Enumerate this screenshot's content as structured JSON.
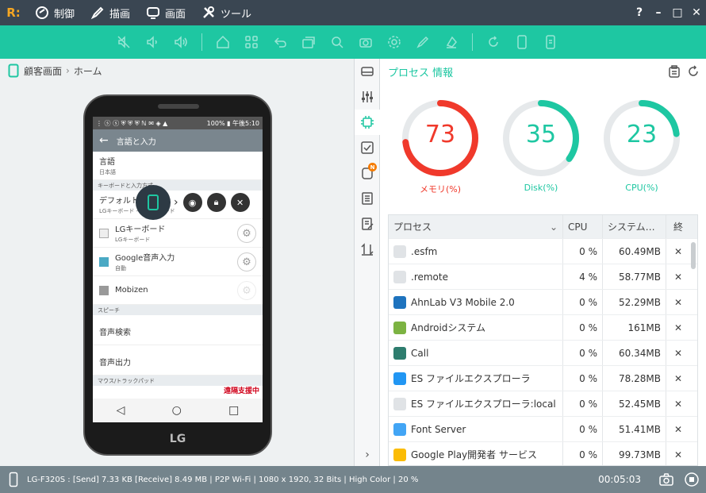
{
  "titlebar": {
    "logo": "R:",
    "menus": [
      "制御",
      "描画",
      "画面",
      "ツール"
    ],
    "controls": [
      "?",
      "–",
      "□",
      "✕"
    ]
  },
  "toolbar": {
    "icons": [
      "mute-icon",
      "volume-down-icon",
      "volume-up-icon",
      "home-icon",
      "apps-icon",
      "back-icon",
      "recent-icon",
      "search-icon",
      "camera-icon",
      "settings-icon",
      "pen-icon",
      "eraser-icon",
      "refresh-icon",
      "phone-portrait-icon",
      "phone-menu-icon"
    ]
  },
  "left": {
    "breadcrumb": [
      "顧客画面",
      "ホーム"
    ],
    "phone": {
      "status_left": "⋮ ⓢ ⓢ ⛨ ⛨ ⛨  ℕ ✉ ◈ ▲",
      "status_right": "100% ▮ 午後5:10",
      "appbar_title": "言語と入力",
      "rows": [
        {
          "title": "言語",
          "sub": "日本語"
        }
      ],
      "section1": "キーボードと入力方式",
      "default_row": {
        "title": "デフォルト",
        "sub": "LGキーボード - LGキーボード"
      },
      "checkrows": [
        {
          "title": "LGキーボード",
          "sub": "LGキーボード"
        },
        {
          "title": "Google音声入力",
          "sub": "自動"
        },
        {
          "title": "Mobizen",
          "sub": ""
        }
      ],
      "section2": "スピーチ",
      "speech_rows": [
        "音声検索",
        "音声出力"
      ],
      "section3": "マウス/トラックパッド",
      "remote_tag": "遠隔支援中",
      "brand": "LG"
    }
  },
  "right": {
    "title": "プロセス 情報",
    "gauges": [
      {
        "value": "73",
        "label": "メモリ(%)",
        "percent": 73,
        "color": "#f0392b"
      },
      {
        "value": "35",
        "label": "Disk(%)",
        "percent": 35,
        "color": "#1ec7a2"
      },
      {
        "value": "23",
        "label": "CPU(%)",
        "percent": 23,
        "color": "#1ec7a2"
      }
    ],
    "table": {
      "headers": [
        "プロセス",
        "CPU",
        "システム…",
        "終"
      ],
      "rows": [
        {
          "name": ".esfm",
          "cpu": "0 %",
          "mem": "60.49MB",
          "icon": "generic-icon",
          "color": "#e0e3e6"
        },
        {
          "name": ".remote",
          "cpu": "4 %",
          "mem": "58.77MB",
          "icon": "generic-icon",
          "color": "#e0e3e6"
        },
        {
          "name": "AhnLab V3 Mobile 2.0",
          "cpu": "0 %",
          "mem": "52.29MB",
          "icon": "v3-icon",
          "color": "#1e73be"
        },
        {
          "name": "Androidシステム",
          "cpu": "0 %",
          "mem": "161MB",
          "icon": "android-icon",
          "color": "#7cb342"
        },
        {
          "name": "Call",
          "cpu": "0 %",
          "mem": "60.34MB",
          "icon": "call-icon",
          "color": "#2e7d6e"
        },
        {
          "name": "ES ファイルエクスプローラ",
          "cpu": "0 %",
          "mem": "78.28MB",
          "icon": "es-icon",
          "color": "#2196f3"
        },
        {
          "name": "ES ファイルエクスプローラ:local",
          "cpu": "0 %",
          "mem": "52.45MB",
          "icon": "generic-icon",
          "color": "#e0e3e6"
        },
        {
          "name": "Font Server",
          "cpu": "0 %",
          "mem": "51.41MB",
          "icon": "font-server-icon",
          "color": "#42a5f5"
        },
        {
          "name": "Google Play開発者 サービス",
          "cpu": "0 %",
          "mem": "99.73MB",
          "icon": "google-play-icon",
          "color": "#fbbc05"
        }
      ]
    }
  },
  "bottombar": {
    "info": "LG-F320S : [Send] 7.33 KB  [Receive] 8.49 MB | P2P Wi-Fi | 1080 x 1920, 32 Bits | High Color | 20 %",
    "timer": "00:05:03"
  }
}
